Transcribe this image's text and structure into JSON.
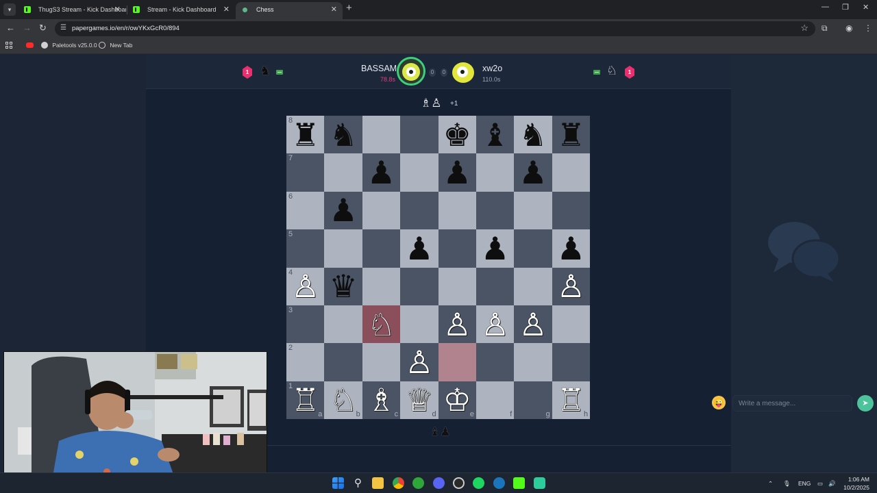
{
  "browser": {
    "tabs": [
      {
        "title": "ThugS3 Stream - Kick Dashboar",
        "icon": "kick-icon",
        "active": false
      },
      {
        "title": "Stream - Kick Dashboard",
        "icon": "kick-icon",
        "active": false
      },
      {
        "title": "Chess",
        "icon": "chess-favicon",
        "active": true
      }
    ],
    "url": "papergames.io/en/r/owYKxGcR0/894",
    "bookmarks": [
      {
        "label": "",
        "icon": "youtube-icon"
      },
      {
        "label": "Paletools v25.0.0",
        "icon": "paletools-icon"
      },
      {
        "label": "New Tab",
        "icon": "globe-icon"
      }
    ]
  },
  "game": {
    "left_player": {
      "name": "BASSAM",
      "time": "78.8s",
      "time_color": "#e0407a",
      "score": "0",
      "level": "1",
      "color": "black"
    },
    "right_player": {
      "name": "xw2o",
      "time": "110.0s",
      "time_color": "#9aa6b6",
      "score": "0",
      "level": "1",
      "color": "white"
    },
    "captured_top": {
      "pieces": "♗♙",
      "extra": "+1"
    },
    "captured_bottom": {
      "pieces": "♝♟"
    },
    "board": {
      "ranks": [
        "8",
        "7",
        "6",
        "5",
        "4",
        "3",
        "2",
        "1"
      ],
      "files": [
        "a",
        "b",
        "c",
        "d",
        "e",
        "f",
        "g",
        "h"
      ],
      "position": [
        [
          "r",
          "n",
          "",
          "",
          "k",
          "b",
          "n",
          "r"
        ],
        [
          "",
          "",
          "p",
          "",
          "p",
          "",
          "p",
          ""
        ],
        [
          "",
          "p",
          "",
          "",
          "",
          "",
          "",
          ""
        ],
        [
          "",
          "",
          "",
          "p",
          "",
          "p",
          "",
          "p"
        ],
        [
          "P",
          "q",
          "",
          "",
          "",
          "",
          "",
          "P"
        ],
        [
          "",
          "",
          "N",
          "",
          "P",
          "P",
          "P",
          ""
        ],
        [
          "",
          "",
          "",
          "P",
          "",
          "",
          "",
          ""
        ],
        [
          "R",
          "N",
          "B",
          "Q",
          "K",
          "",
          "",
          "R"
        ]
      ],
      "last_move": {
        "from": "e2",
        "to": "c3"
      }
    }
  },
  "chat": {
    "placeholder": "Write a message..."
  },
  "taskbar": {
    "apps": [
      "windows-start-icon",
      "search-icon",
      "file-explorer-icon",
      "chrome-icon",
      "xbox-icon",
      "discord-icon",
      "obs-icon",
      "spotify-icon",
      "steam-icon",
      "kick-icon",
      "app-icon"
    ],
    "tray": {
      "language": "ENG",
      "time": "1:06 AM",
      "date": "10/2/2025"
    }
  }
}
